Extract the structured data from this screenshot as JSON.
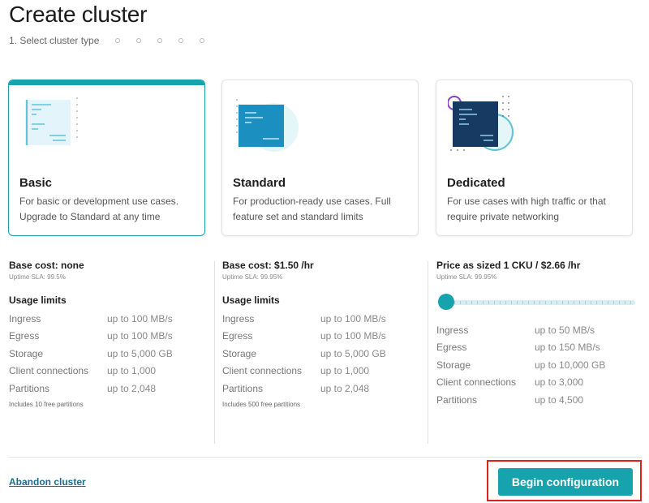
{
  "header": {
    "title": "Create cluster",
    "step_label": "1. Select cluster type",
    "remaining_steps": 5
  },
  "colors": {
    "accent": "#16a3ad",
    "link": "#1d6c8c",
    "highlight": "#e0201b"
  },
  "cards": [
    {
      "name": "Basic",
      "desc": "For basic or development use cases. Upgrade to Standard at any time",
      "selected": true,
      "icon": "basic-cluster-illustration"
    },
    {
      "name": "Standard",
      "desc": "For production-ready use cases. Full feature set and standard limits",
      "selected": false,
      "icon": "standard-cluster-illustration"
    },
    {
      "name": "Dedicated",
      "desc": "For use cases with high traffic or that require private networking",
      "selected": false,
      "icon": "dedicated-cluster-illustration"
    }
  ],
  "basic": {
    "base_cost": "Base cost: none",
    "sla": "Uptime SLA: 99.5%",
    "usage_title": "Usage limits",
    "limits": [
      {
        "label": "Ingress",
        "value": "up to 100 MB/s"
      },
      {
        "label": "Egress",
        "value": "up to 100 MB/s"
      },
      {
        "label": "Storage",
        "value": "up to 5,000 GB"
      },
      {
        "label": "Client connections",
        "value": "up to 1,000"
      },
      {
        "label": "Partitions",
        "value": "up to 2,048"
      }
    ],
    "note": "Includes 10 free partitions"
  },
  "standard": {
    "base_cost": "Base cost: $1.50 /hr",
    "sla": "Uptime SLA: 99.95%",
    "usage_title": "Usage limits",
    "limits": [
      {
        "label": "Ingress",
        "value": "up to 100 MB/s"
      },
      {
        "label": "Egress",
        "value": "up to 100 MB/s"
      },
      {
        "label": "Storage",
        "value": "up to 5,000 GB"
      },
      {
        "label": "Client connections",
        "value": "up to 1,000"
      },
      {
        "label": "Partitions",
        "value": "up to 2,048"
      }
    ],
    "note": "Includes 500 free partitions"
  },
  "dedicated": {
    "price": "Price as sized 1 CKU / $2.66 /hr",
    "sla": "Uptime SLA: 99.95%",
    "slider_value": 0,
    "limits": [
      {
        "label": "Ingress",
        "value": "up to 50 MB/s"
      },
      {
        "label": "Egress",
        "value": "up to 150 MB/s"
      },
      {
        "label": "Storage",
        "value": "up to 10,000 GB"
      },
      {
        "label": "Client connections",
        "value": "up to 3,000"
      },
      {
        "label": "Partitions",
        "value": "up to 4,500"
      }
    ]
  },
  "footer": {
    "abandon_label": "Abandon cluster",
    "begin_label": "Begin configuration"
  }
}
